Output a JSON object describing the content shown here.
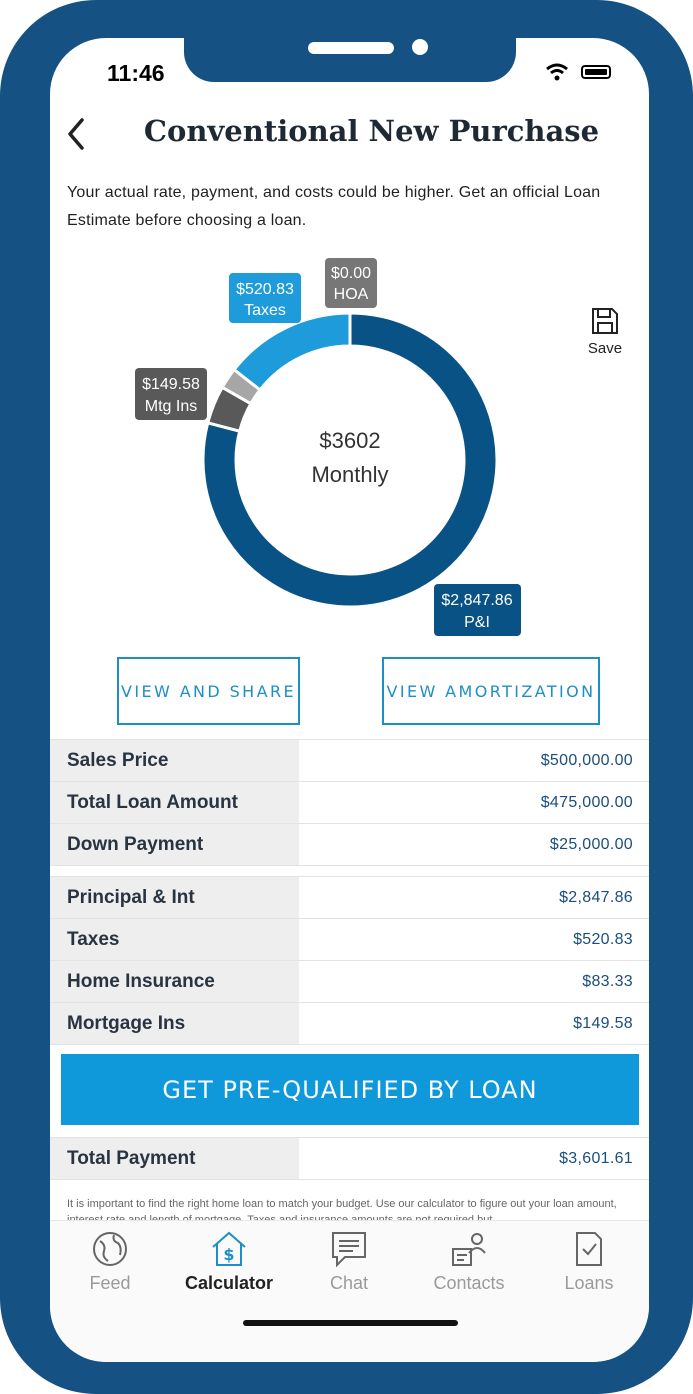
{
  "status": {
    "time": "11:46"
  },
  "header": {
    "title": "Conventional New Purchase"
  },
  "disclaimer": "Your actual rate, payment, and costs could be higher. Get an official Loan Estimate before choosing a loan.",
  "chart_data": {
    "type": "pie",
    "center_amount": "$3602",
    "center_label": "Monthly",
    "slices": [
      {
        "label": "P&I",
        "value_text": "$2,847.86",
        "value": 2847.86,
        "color": "#095285"
      },
      {
        "label": "Mtg Ins",
        "value_text": "$149.58",
        "value": 149.58,
        "color": "#595959"
      },
      {
        "label": "Taxes",
        "value_text": "$520.83",
        "value": 520.83,
        "color": "#1e9bda"
      },
      {
        "label": "HOA",
        "value_text": "$0.00",
        "value": 0,
        "color": "#777777"
      }
    ],
    "unlabeled_slices": [
      {
        "value": 83.33,
        "color": "#a6a6a6"
      }
    ]
  },
  "save": {
    "label": "Save"
  },
  "actions": {
    "view_share": "VIEW AND SHARE",
    "view_amortization": "VIEW AMORTIZATION"
  },
  "loan_summary": [
    {
      "label": "Sales Price",
      "value": "$500,000.00"
    },
    {
      "label": "Total Loan Amount",
      "value": "$475,000.00"
    },
    {
      "label": "Down Payment",
      "value": "$25,000.00"
    }
  ],
  "payment_breakdown": [
    {
      "label": "Principal & Int",
      "value": "$2,847.86"
    },
    {
      "label": "Taxes",
      "value": "$520.83"
    },
    {
      "label": "Home Insurance",
      "value": "$83.33"
    },
    {
      "label": "Mortgage Ins",
      "value": "$149.58"
    }
  ],
  "cta": {
    "label": "GET PRE-QUALIFIED BY LOAN"
  },
  "total": {
    "label": "Total Payment",
    "value": "$3,601.61"
  },
  "fineprint": "It is important to find the right home loan to match your budget. Use our calculator to figure out your loan amount, interest rate and length of mortgage. Taxes and insurance amounts are not required but",
  "tabs": [
    {
      "label": "Feed",
      "icon": "globe-icon"
    },
    {
      "label": "Calculator",
      "icon": "house-dollar-icon",
      "active": true
    },
    {
      "label": "Chat",
      "icon": "chat-icon"
    },
    {
      "label": "Contacts",
      "icon": "contacts-icon"
    },
    {
      "label": "Loans",
      "icon": "document-check-icon"
    }
  ],
  "colors": {
    "frame": "#155283",
    "accent": "#0f98da",
    "primary_dark": "#095285"
  }
}
